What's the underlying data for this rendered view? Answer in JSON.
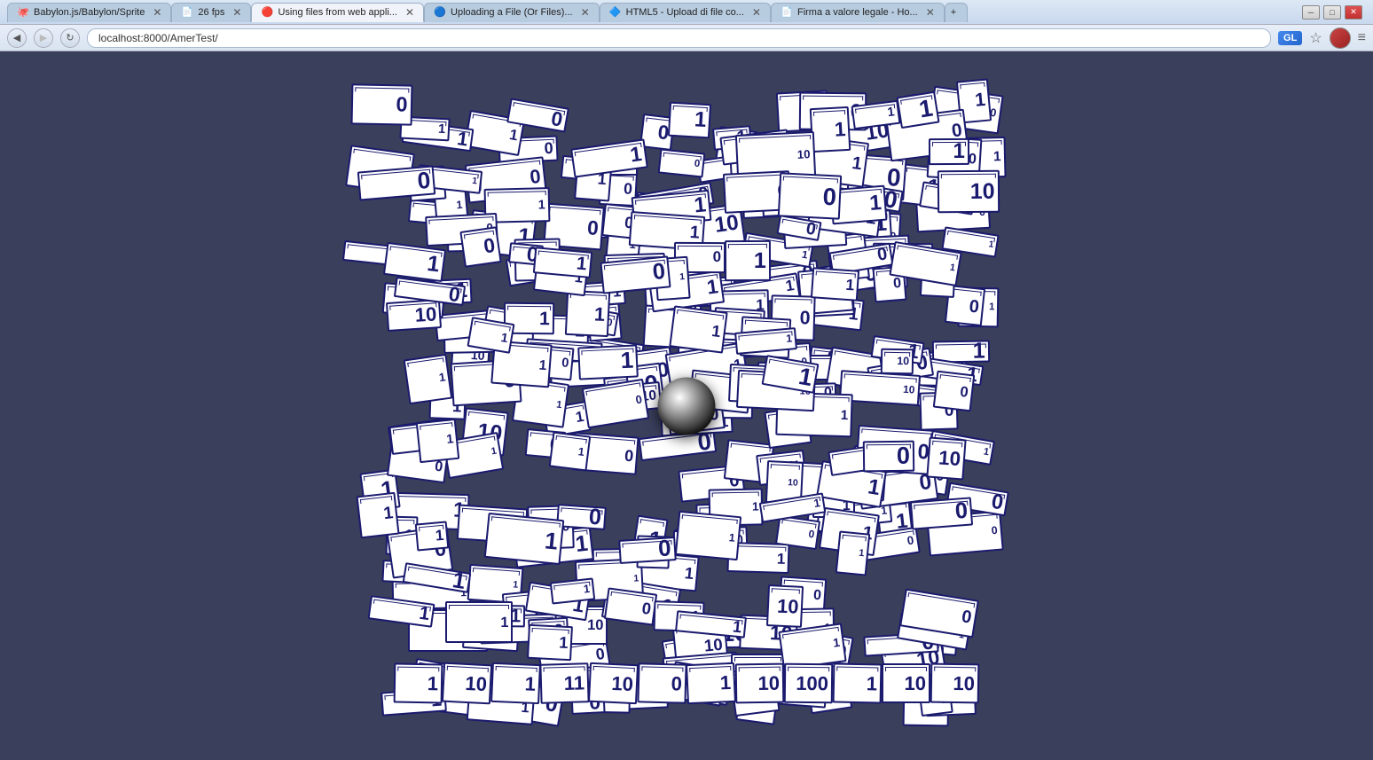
{
  "browser": {
    "tabs": [
      {
        "id": "tab1",
        "label": "Babylon.js/Babylon/Sprite",
        "favicon": "🐙",
        "active": false
      },
      {
        "id": "tab2",
        "label": "26 fps",
        "favicon": "📄",
        "active": false
      },
      {
        "id": "tab3",
        "label": "Using files from web appli...",
        "favicon": "🔴",
        "active": true
      },
      {
        "id": "tab4",
        "label": "Uploading a File (Or Files)...",
        "favicon": "🔵",
        "active": false
      },
      {
        "id": "tab5",
        "label": "HTML5 - Upload di file co...",
        "favicon": "🔷",
        "active": false
      },
      {
        "id": "tab6",
        "label": "Firma a valore legale - Ho...",
        "favicon": "📄",
        "active": false
      }
    ],
    "address": "localhost:8000/AmerTest/",
    "gl_badge": "GL"
  },
  "canvas": {
    "background_color": "#3a3f5c",
    "sphere_present": true
  }
}
